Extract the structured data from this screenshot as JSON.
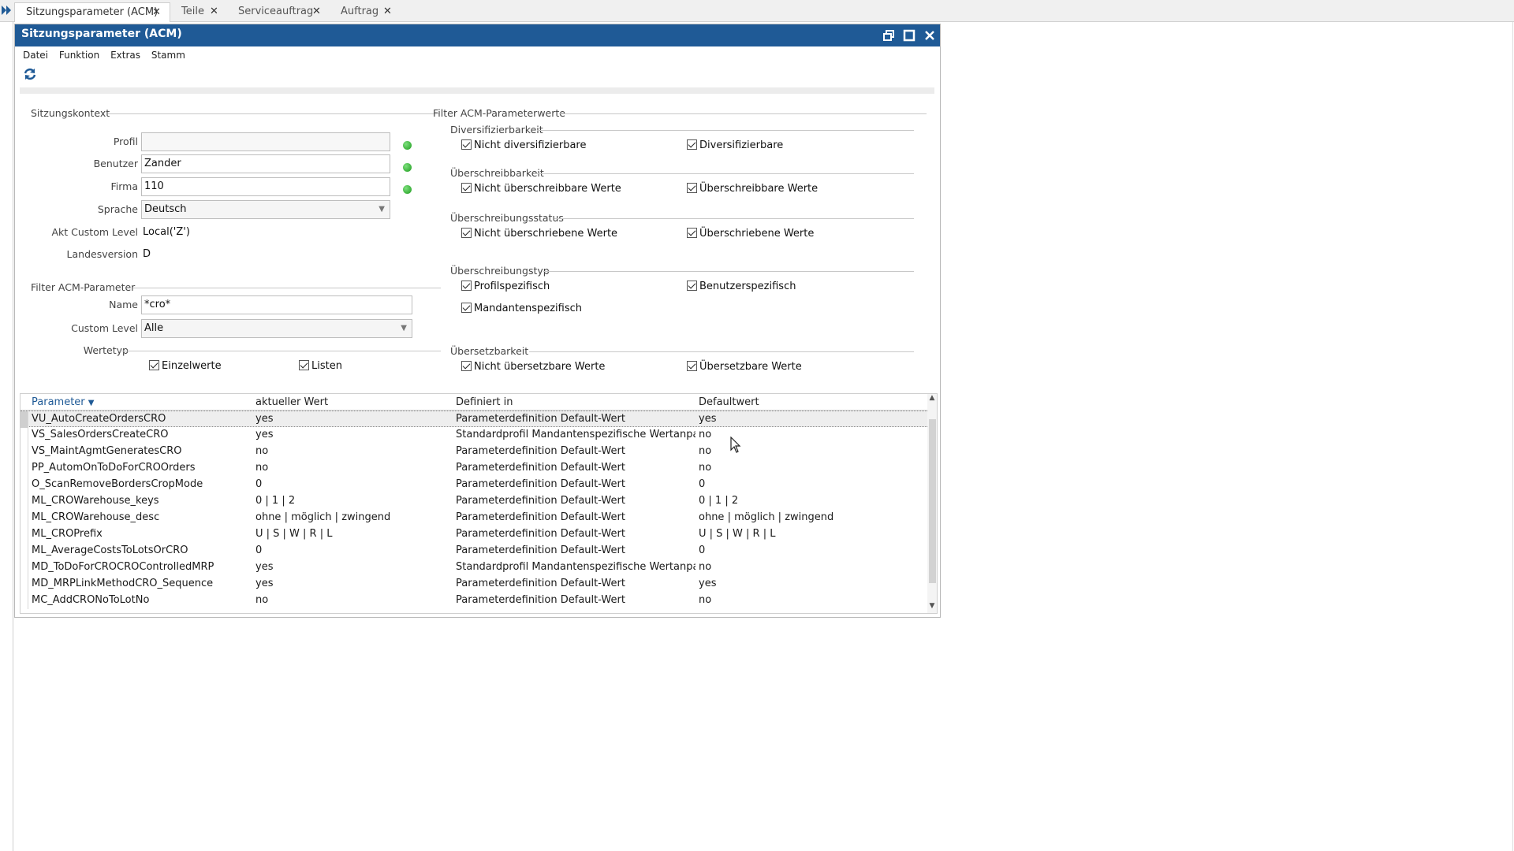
{
  "tabs": [
    {
      "label": "Sitzungsparameter (ACM)",
      "active": true
    },
    {
      "label": "Teile",
      "active": false
    },
    {
      "label": "Serviceauftrag",
      "active": false
    },
    {
      "label": "Auftrag",
      "active": false
    }
  ],
  "window": {
    "title": "Sitzungsparameter (ACM)"
  },
  "menu": [
    "Datei",
    "Funktion",
    "Extras",
    "Stamm"
  ],
  "session": {
    "group_title": "Sitzungskontext",
    "profil_label": "Profil",
    "profil_value": "",
    "benutzer_label": "Benutzer",
    "benutzer_value": "Zander",
    "firma_label": "Firma",
    "firma_value": "110",
    "sprache_label": "Sprache",
    "sprache_value": "Deutsch",
    "custom_level_label": "Akt Custom Level",
    "custom_level_value": "Local('Z')",
    "landesversion_label": "Landesversion",
    "landesversion_value": "D"
  },
  "filter_params": {
    "group_title": "Filter ACM-Parameter",
    "name_label": "Name",
    "name_value": "*cro*",
    "custom_level_label": "Custom Level",
    "custom_level_value": "Alle",
    "wertetyp_label": "Wertetyp",
    "einzelwerte": "Einzelwerte",
    "listen": "Listen"
  },
  "filter_values": {
    "group_title": "Filter ACM-Parameterwerte",
    "groups": [
      {
        "title": "Diversifizierbarkeit",
        "left": "Nicht diversifizierbare",
        "right": "Diversifizierbare"
      },
      {
        "title": "Überschreibbarkeit",
        "left": "Nicht überschreibbare Werte",
        "right": "Überschreibbare Werte"
      },
      {
        "title": "Überschreibungsstatus",
        "left": "Nicht überschriebene Werte",
        "right": "Überschriebene Werte"
      },
      {
        "title": "Überschreibungstyp",
        "left": "Profilspezifisch",
        "right": "Benutzerspezifisch",
        "extra": "Mandantenspezifisch"
      },
      {
        "title": "Übersetzbarkeit",
        "left": "Nicht übersetzbare Werte",
        "right": "Übersetzbare Werte"
      }
    ]
  },
  "grid": {
    "columns": [
      "Parameter",
      "aktueller Wert",
      "Definiert in",
      "Defaultwert"
    ],
    "rows": [
      [
        "VU_AutoCreateOrdersCRO",
        "yes",
        "Parameterdefinition Default-Wert",
        "yes"
      ],
      [
        "VS_SalesOrdersCreateCRO",
        "yes",
        "Standardprofil Mandantenspezifische Wertanpassung",
        "no"
      ],
      [
        "VS_MaintAgmtGeneratesCRO",
        "no",
        "Parameterdefinition Default-Wert",
        "no"
      ],
      [
        "PP_AutomOnToDoForCROOrders",
        "no",
        "Parameterdefinition Default-Wert",
        "no"
      ],
      [
        "O_ScanRemoveBordersCropMode",
        "0",
        "Parameterdefinition Default-Wert",
        "0"
      ],
      [
        "ML_CROWarehouse_keys",
        "0 | 1 | 2",
        "Parameterdefinition Default-Wert",
        "0 | 1 | 2"
      ],
      [
        "ML_CROWarehouse_desc",
        "ohne | möglich | zwingend",
        "Parameterdefinition Default-Wert",
        "ohne | möglich | zwingend"
      ],
      [
        "ML_CROPrefix",
        "U | S | W | R | L",
        "Parameterdefinition Default-Wert",
        "U | S | W | R | L"
      ],
      [
        "ML_AverageCostsToLotsOrCRO",
        "0",
        "Parameterdefinition Default-Wert",
        "0"
      ],
      [
        "MD_ToDoForCROCROControlledMRP",
        "yes",
        "Standardprofil Mandantenspezifische Wertanpassung",
        "no"
      ],
      [
        "MD_MRPLinkMethodCRO_Sequence",
        "yes",
        "Parameterdefinition Default-Wert",
        "yes"
      ],
      [
        "MC_AddCRONoToLotNo",
        "no",
        "Parameterdefinition Default-Wert",
        "no"
      ]
    ]
  },
  "colors": {
    "titlebar": "#1f5a96",
    "status_dot": "#1c9b1c",
    "sort_header": "#1f5a96"
  }
}
